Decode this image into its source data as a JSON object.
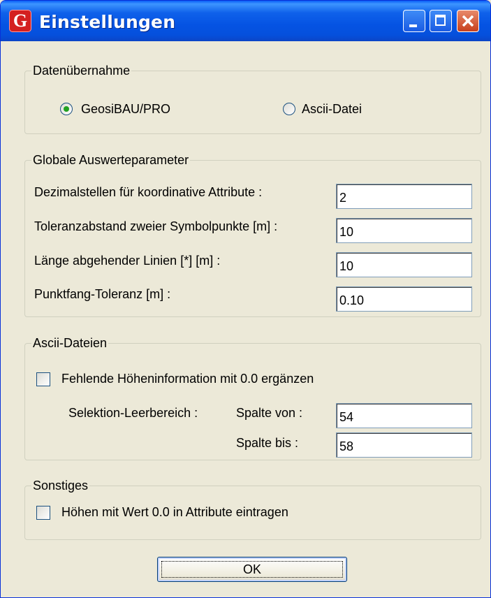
{
  "window": {
    "title": "Einstellungen",
    "app_icon_letter": "G",
    "icon_names": [
      "minimize-icon",
      "maximize-icon",
      "close-icon"
    ]
  },
  "data_import": {
    "legend": "Datenübernahme",
    "options": [
      {
        "label": "GeosiBAU/PRO",
        "selected": true
      },
      {
        "label": "Ascii-Datei",
        "selected": false
      }
    ]
  },
  "global_params": {
    "legend": "Globale Auswerteparameter",
    "fields": [
      {
        "label": "Dezimalstellen für koordinative Attribute :",
        "value": "2"
      },
      {
        "label": "Toleranzabstand zweier Symbolpunkte [m] :",
        "value": "10"
      },
      {
        "label": "Länge abgehender Linien [*] [m] :",
        "value": "10"
      },
      {
        "label": "Punktfang-Toleranz [m] :",
        "value": "0.10"
      }
    ]
  },
  "ascii_files": {
    "legend": "Ascii-Dateien",
    "fill_missing_height": {
      "label": "Fehlende Höheninformation mit 0.0 ergänzen",
      "checked": false
    },
    "selection_label": "Selektion-Leerbereich :",
    "column_from": {
      "label": "Spalte von :",
      "value": "54"
    },
    "column_to": {
      "label": "Spalte bis :",
      "value": "58"
    }
  },
  "misc": {
    "legend": "Sonstiges",
    "heights_zero": {
      "label": "Höhen mit Wert 0.0 in Attribute eintragen",
      "checked": false
    }
  },
  "ok_button": {
    "label": "OK"
  },
  "colors": {
    "title_bar": "#0553e3",
    "dialog_bg": "#ece9d8",
    "close_button": "#c7401c",
    "radio_dot": "#21a121"
  }
}
